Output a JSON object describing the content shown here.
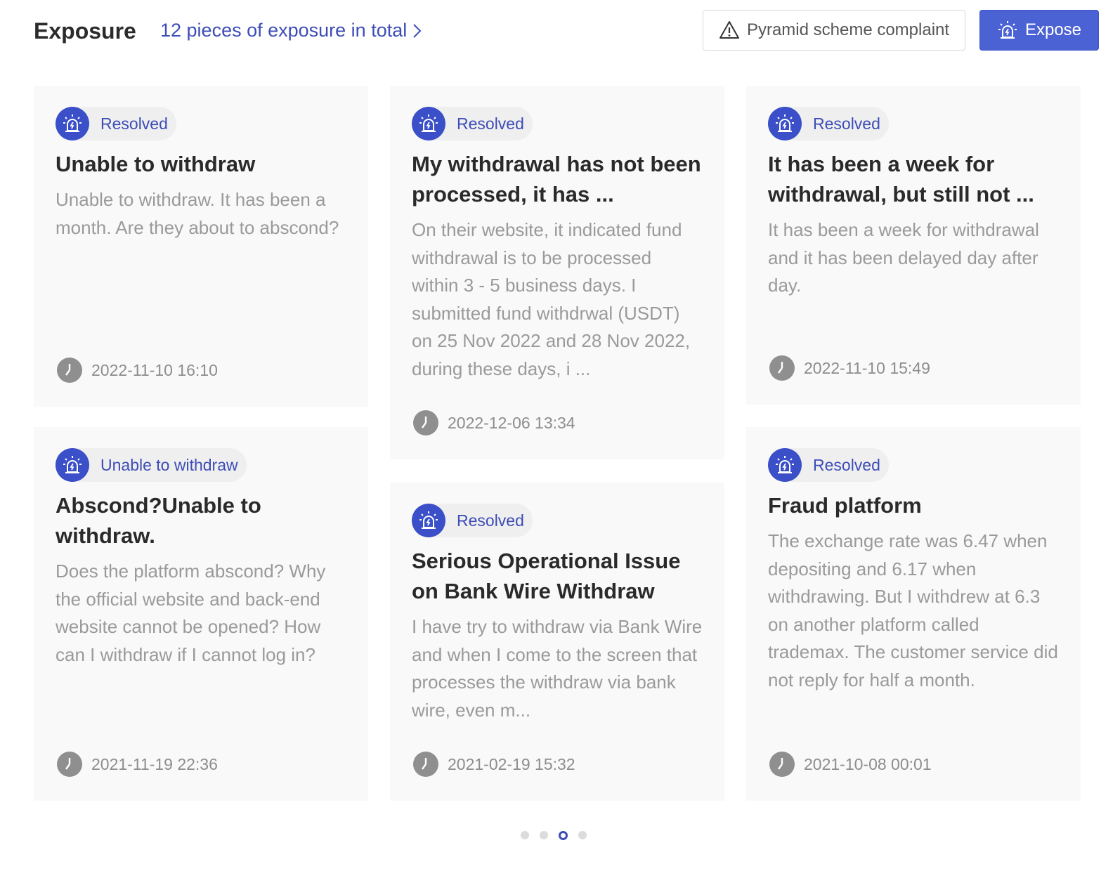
{
  "header": {
    "title": "Exposure",
    "total_link": "12 pieces of exposure in total",
    "complaint_button": "Pyramid scheme complaint",
    "expose_button": "Expose"
  },
  "cards": [
    {
      "status": "Resolved",
      "title": "Unable to withdraw",
      "description": "Unable to withdraw. It has been a month. Are they about to abscond?",
      "time": "2022-11-10 16:10"
    },
    {
      "status": "Resolved",
      "title": "My withdrawal has not been processed, it has ...",
      "description": "On their website, it indicated fund withdrawal is to be processed within 3 - 5 business days. I submitted fund withdrwal (USDT) on 25 Nov 2022 and 28 Nov 2022, during these days, i ...",
      "time": "2022-12-06 13:34"
    },
    {
      "status": "Resolved",
      "title": "It has been a week for withdrawal, but still not ...",
      "description": "It has been a week for withdrawal and it has been delayed day after day.",
      "time": "2022-11-10 15:49"
    },
    {
      "status": "Unable to withdraw",
      "title": "Abscond?Unable to withdraw.",
      "description": "Does the platform abscond? Why the official website and back-end website cannot be opened? How can I withdraw if I cannot log in?",
      "time": "2021-11-19 22:36"
    },
    {
      "status": "Resolved",
      "title": "Serious Operational Issue on Bank Wire Withdraw",
      "description": "I have try to withdraw via Bank Wire and when I come to the screen that processes the withdraw via bank wire, even m...",
      "time": "2021-02-19 15:32"
    },
    {
      "status": "Resolved",
      "title": "Fraud platform",
      "description": "The exchange rate was 6.47 when depositing and 6.17 when withdrawing. But I withdrew at 6.3 on another platform called trademax. The customer service did not reply for half a month.",
      "time": "2021-10-08 00:01"
    }
  ],
  "pagination": {
    "total_pages": 4,
    "current_page": 3
  },
  "colors": {
    "accent": "#3d4db7",
    "button_primary": "#4b62d4",
    "card_bg": "#f9f9f9",
    "muted_text": "#9a9a9a"
  },
  "icons": {
    "status": "alarm-light-icon",
    "time": "clock-icon",
    "warning": "warning-triangle-icon",
    "chevron": "chevron-right-icon"
  }
}
